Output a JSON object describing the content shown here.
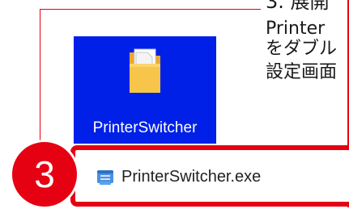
{
  "instruction": {
    "line1": "3. 展開",
    "line2": "Printer",
    "line3": "をダブル",
    "line4": "設定画面"
  },
  "desktop_folder": {
    "label": "PrinterSwitcher",
    "icon": "folder-icon"
  },
  "step_badge": {
    "number": "3"
  },
  "file_item": {
    "name": "PrinterSwitcher.exe",
    "icon": "application-exe-icon"
  },
  "colors": {
    "accent_red": "#e50012",
    "selection_blue": "#0020e8",
    "folder_yellow": "#f6c54a"
  }
}
